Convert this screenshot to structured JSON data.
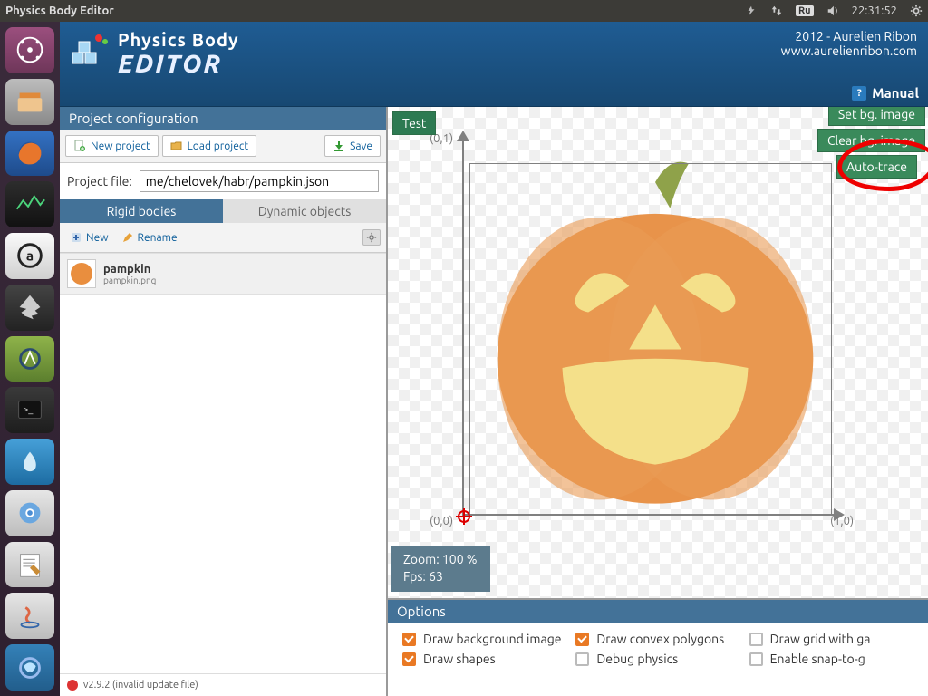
{
  "sysbar": {
    "title": "Physics Body Editor",
    "lang": "Ru",
    "time": "22:31:52"
  },
  "banner": {
    "line1": "Physics Body",
    "line2": "EDITOR",
    "credit1": "2012 - Aurelien Ribon",
    "credit2": "www.aurelienribon.com",
    "manual": "Manual"
  },
  "projconf": {
    "heading": "Project configuration",
    "new_label": "New project",
    "load_label": "Load project",
    "save_label": "Save",
    "file_label": "Project file:",
    "file_value": "me/chelovek/habr/pampkin.json"
  },
  "tabs": {
    "rigid": "Rigid bodies",
    "dynamic": "Dynamic objects"
  },
  "toolbar": {
    "new": "New",
    "rename": "Rename"
  },
  "item": {
    "name": "pampkin",
    "file": "pampkin.png"
  },
  "status": "v2.9.2 (invalid update file)",
  "canvas": {
    "test": "Test",
    "setbg": "Set bg. image",
    "clearbg": "Clear bg. image",
    "autotrace": "Auto-trace",
    "c00": "(0,0)",
    "c01": "(0,1)",
    "c10": "(1,0)",
    "zoom": "Zoom: 100 %",
    "fps": "Fps: 63"
  },
  "options": {
    "heading": "Options",
    "drawbg": "Draw background image",
    "drawshapes": "Draw shapes",
    "drawconvex": "Draw convex polygons",
    "debug": "Debug physics",
    "drawgrid": "Draw grid with ga",
    "snap": "Enable snap-to-g"
  }
}
